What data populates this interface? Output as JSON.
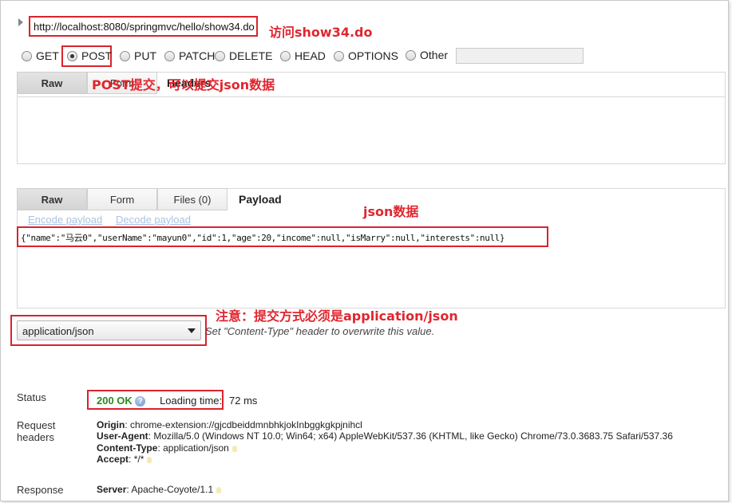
{
  "request": {
    "url": "http://localhost:8080/springmvc/hello/show34.do",
    "methods": [
      {
        "label": "GET",
        "checked": false
      },
      {
        "label": "POST",
        "checked": true
      },
      {
        "label": "PUT",
        "checked": false
      },
      {
        "label": "PATCH",
        "checked": false
      },
      {
        "label": "DELETE",
        "checked": false
      },
      {
        "label": "HEAD",
        "checked": false
      },
      {
        "label": "OPTIONS",
        "checked": false
      },
      {
        "label": "Other",
        "checked": false
      }
    ],
    "other_value": ""
  },
  "headers_tabs": {
    "raw": "Raw",
    "form": "Form",
    "headers": "Headers"
  },
  "payload_tabs": {
    "raw": "Raw",
    "form": "Form",
    "files": "Files (0)",
    "payload": "Payload"
  },
  "payload_links": {
    "encode": "Encode payload",
    "decode": "Decode payload"
  },
  "payload_body": "{\"name\":\"马云0\",\"userName\":\"mayun0\",\"id\":1,\"age\":20,\"income\":null,\"isMarry\":null,\"interests\":null}",
  "content_type": {
    "selected": "application/json",
    "hint": "Set \"Content-Type\" header to overwrite this value."
  },
  "response": {
    "status_label": "Status",
    "status_code": "200 OK",
    "loading_label": "Loading time:",
    "loading_value": "72 ms",
    "request_headers_label_1": "Request",
    "request_headers_label_2": "headers",
    "request_headers": [
      {
        "key": "Origin",
        "value": "chrome-extension://gjcdbeiddmnbhkjokInbggkgkpjnihcl"
      },
      {
        "key": "User-Agent",
        "value": "Mozilla/5.0 (Windows NT 10.0; Win64; x64) AppleWebKit/537.36 (KHTML, like Gecko) Chrome/73.0.3683.75 Safari/537.36"
      },
      {
        "key": "Content-Type",
        "value": "application/json"
      },
      {
        "key": "Accept",
        "value": "*/*"
      }
    ],
    "response_label": "Response",
    "response_headers": [
      {
        "key": "Server",
        "value": "Apache-Coyote/1.1"
      }
    ]
  },
  "annotations": {
    "visit": "访问show34.do",
    "post_note": "POST提交，可以提交json数据",
    "json_note": "json数据",
    "content_type_note": "注意：提交方式必须是application/json"
  },
  "colors": {
    "annotation": "#e0262f",
    "status_ok": "#2a8a1f"
  }
}
